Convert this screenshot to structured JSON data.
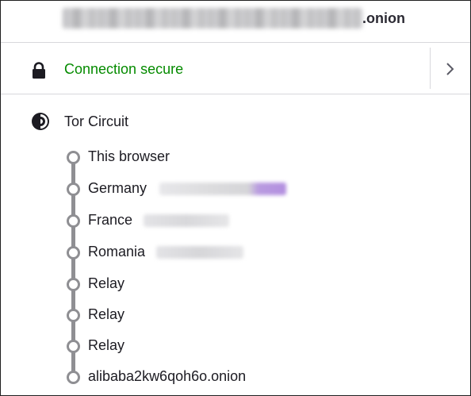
{
  "header": {
    "host_suffix": ".onion"
  },
  "connection": {
    "label": "Connection secure",
    "color": "#058b00",
    "icon": "lock-icon"
  },
  "tor_circuit": {
    "title": "Tor Circuit",
    "icon": "tor-onion-icon",
    "nodes": [
      {
        "label": "This browser",
        "redacted_ip": false
      },
      {
        "label": "Germany",
        "redacted_ip": true
      },
      {
        "label": "France",
        "redacted_ip": true
      },
      {
        "label": "Romania",
        "redacted_ip": true
      },
      {
        "label": "Relay",
        "redacted_ip": false
      },
      {
        "label": "Relay",
        "redacted_ip": false
      },
      {
        "label": "Relay",
        "redacted_ip": false
      },
      {
        "label": "alibaba2kw6qoh6o.onion",
        "redacted_ip": false
      }
    ]
  }
}
